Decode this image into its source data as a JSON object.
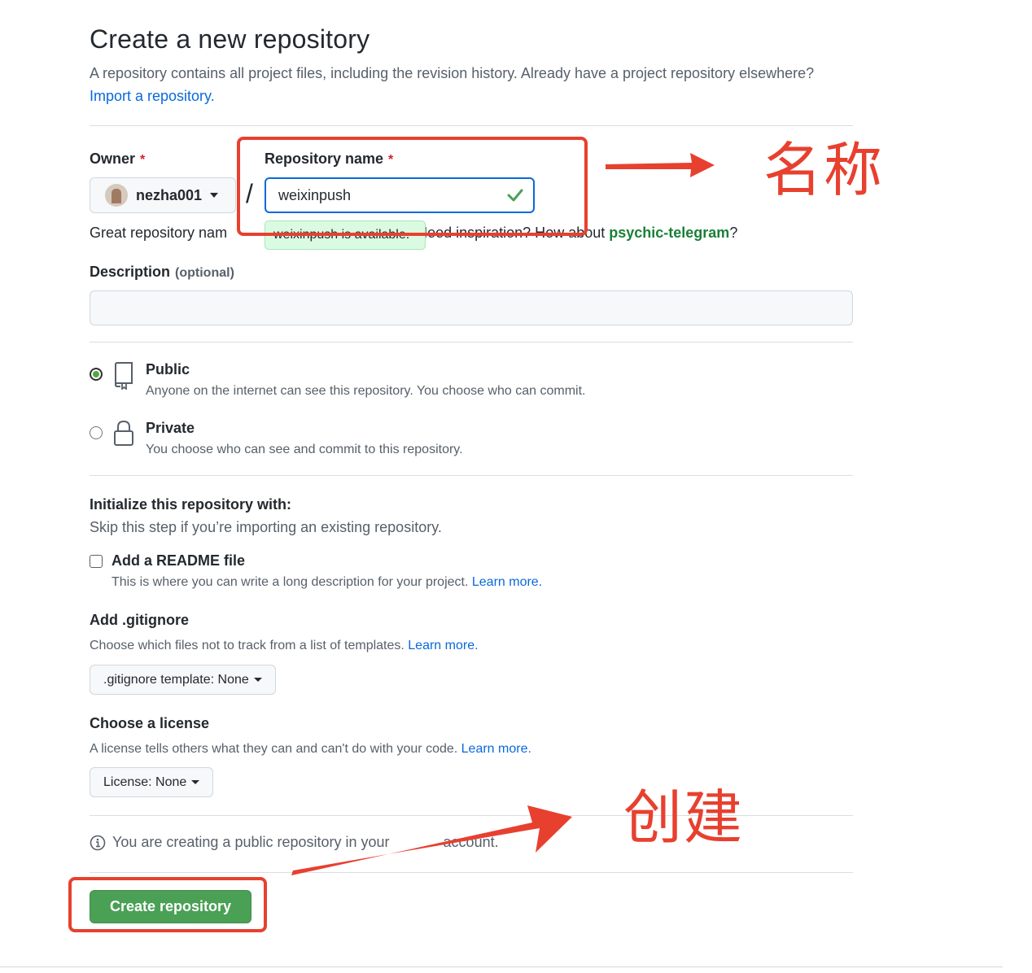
{
  "header": {
    "title": "Create a new repository",
    "subtitle": "A repository contains all project files, including the revision history. Already have a project repository elsewhere?",
    "import_link": "Import a repository."
  },
  "owner": {
    "label": "Owner",
    "required_mark": "*",
    "value": "nezha001"
  },
  "repo_name": {
    "label": "Repository name",
    "required_mark": "*",
    "value": "weixinpush",
    "availability": "weixinpush is available."
  },
  "hint": {
    "prefix": "Great repository nam",
    "middle": "e. Need inspiration? H",
    "suffix_before": "ow about ",
    "suggestion": "psychic-telegram",
    "suffix": "?"
  },
  "description": {
    "label": "Description",
    "optional": "(optional)",
    "value": ""
  },
  "visibility": {
    "selected": "Public",
    "options": [
      {
        "title": "Public",
        "desc": "Anyone on the internet can see this repository. You choose who can commit.",
        "icon": "repo-icon"
      },
      {
        "title": "Private",
        "desc": "You choose who can see and commit to this repository.",
        "icon": "lock-icon"
      }
    ]
  },
  "initialize": {
    "title": "Initialize this repository with:",
    "desc": "Skip this step if you’re importing an existing repository.",
    "readme_label": "Add a README file",
    "readme_checked": false,
    "readme_desc": "This is where you can write a long description for your project.",
    "learn_more": "Learn more."
  },
  "gitignore": {
    "title": "Add .gitignore",
    "desc": "Choose which files not to track from a list of templates.",
    "learn_more": "Learn more.",
    "select": ".gitignore template: None"
  },
  "license": {
    "title": "Choose a license",
    "desc": "A license tells others what they can and can't do with your code.",
    "learn_more": "Learn more.",
    "select": "License: None"
  },
  "notice": {
    "text": "You are creating a public repository in your",
    "tail": "account."
  },
  "actions": {
    "create_label": "Create repository"
  },
  "annotations": {
    "name_label": "名称",
    "create_label": "创建",
    "color": "#e8402f"
  },
  "colors": {
    "primary_button": "#4aa055",
    "link": "#0969da",
    "success": "#1a7f37"
  }
}
